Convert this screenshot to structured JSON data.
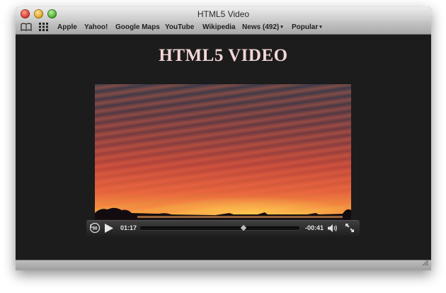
{
  "window": {
    "title": "HTML5 Video"
  },
  "bookmarks_bar": {
    "icons": [
      "book-icon",
      "grid-icon"
    ],
    "items": [
      {
        "label": "Apple"
      },
      {
        "label": "Yahoo!"
      },
      {
        "label": "Google Maps"
      },
      {
        "label": "YouTube"
      },
      {
        "label": "Wikipedia"
      },
      {
        "label": "News (492)",
        "has_menu": true
      },
      {
        "label": "Popular",
        "has_menu": true
      }
    ],
    "menu_arrow": "▾"
  },
  "page": {
    "heading": "HTML5 VIDEO",
    "heading_color": "#f3d5d5",
    "background_color": "#1c1c1c"
  },
  "video_player": {
    "controls": {
      "rewind_label": "30",
      "play_icon": "play-icon",
      "elapsed_time": "01:17",
      "remaining_time": "-00:41",
      "progress_fraction": 0.65,
      "volume_icon": "speaker-icon",
      "fullscreen_icon": "fullscreen-icon"
    }
  }
}
